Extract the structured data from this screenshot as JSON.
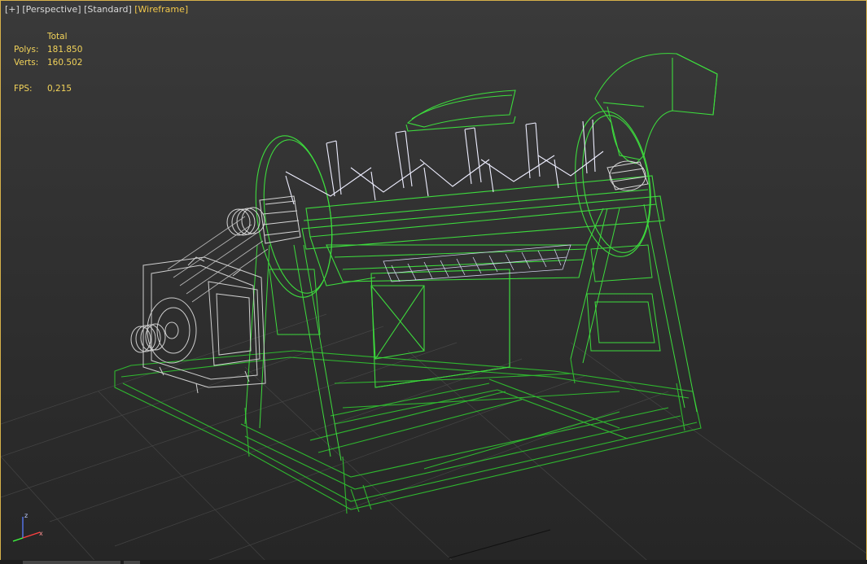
{
  "viewport": {
    "labels": {
      "menu": "[+]",
      "view": "[Perspective]",
      "shading_std": "[Standard]",
      "shading_mode": "[Wireframe]"
    },
    "stats": {
      "header": "Total",
      "polys_label": "Polys:",
      "polys_value": "181.850",
      "verts_label": "Verts:",
      "verts_value": "160.502",
      "fps_label": "FPS:",
      "fps_value": "0,215"
    },
    "gizmo": {
      "z": "z",
      "x": "x"
    },
    "colors": {
      "border": "#d6b14a",
      "label_active": "#f2c84b",
      "stats": "#f2d35a",
      "wire_green": "#3ddb3d",
      "wire_frame": "#2fb82f",
      "wire_white": "#e8e8ff",
      "wire_gray": "#cfcfcf",
      "grid": "#5a5a5a"
    }
  }
}
